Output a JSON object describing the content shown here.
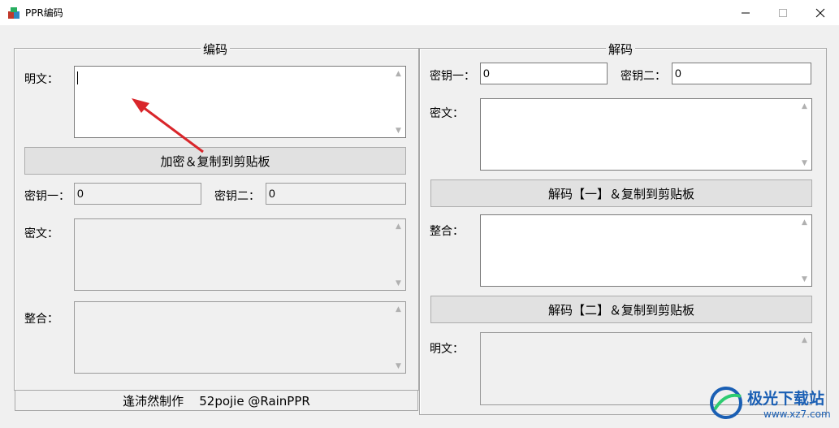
{
  "window": {
    "title": "PPR编码"
  },
  "encode": {
    "group_title": "编码",
    "plaintext_label": "明文：",
    "button_label": "加密＆复制到剪贴板",
    "key1_label": "密钥一：",
    "key1_value": "0",
    "key2_label": "密钥二：",
    "key2_value": "0",
    "ciphertext_label": "密文：",
    "combined_label": "整合："
  },
  "decode": {
    "group_title": "解码",
    "key1_label": "密钥一：",
    "key1_value": "0",
    "key2_label": "密钥二：",
    "key2_value": "0",
    "ciphertext_label": "密文：",
    "button1_label": "解码【一】＆复制到剪贴板",
    "combined_label": "整合：",
    "button2_label": "解码【二】＆复制到剪贴板",
    "plaintext_label": "明文："
  },
  "status": {
    "text": "逢沛然制作    52pojie @RainPPR"
  },
  "watermark": {
    "main": "极光下载站",
    "sub": "www.xz7.com"
  },
  "colors": {
    "arrow": "#d9262b",
    "watermark": "#1a5fb4"
  }
}
